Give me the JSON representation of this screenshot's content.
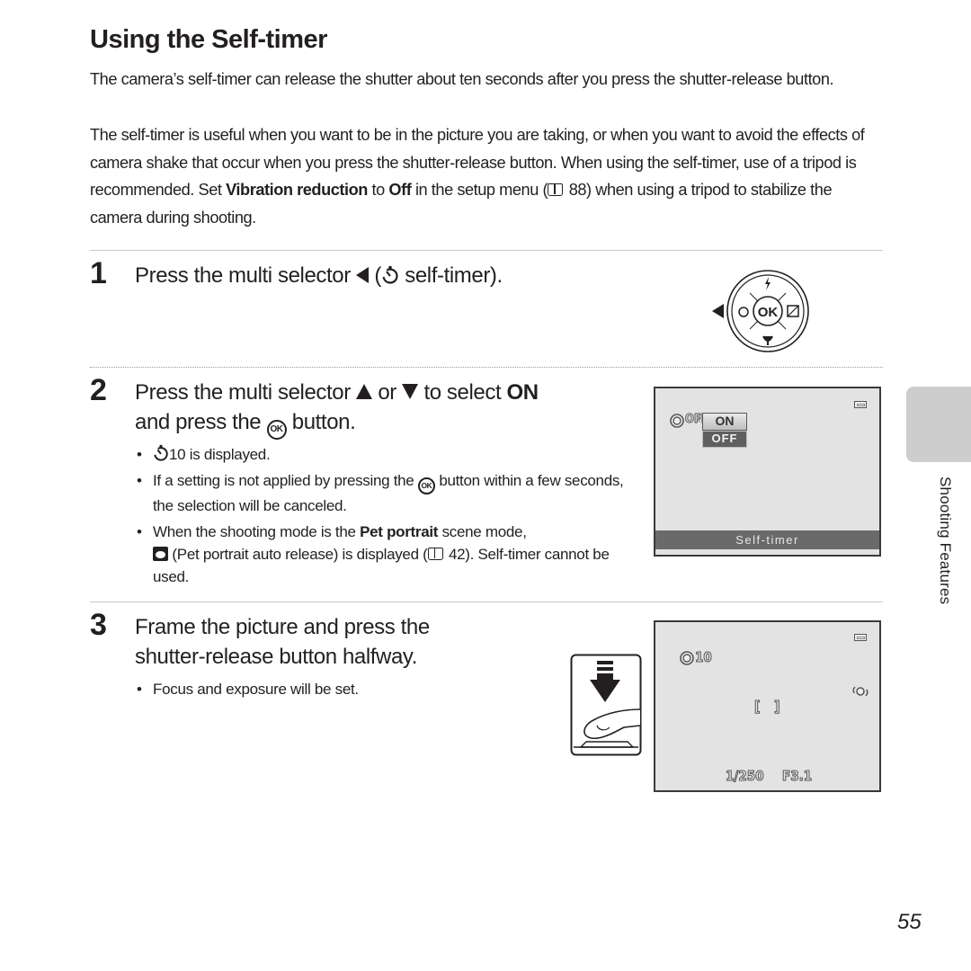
{
  "page": {
    "title": "Using the Self-timer",
    "intro_p1": "The camera’s self-timer can release the shutter about ten seconds after you press the shutter-release button.",
    "intro_p2_a": "The self-timer is useful when you want to be in the picture you are taking, or when you want to avoid the effects of camera shake that occur when you press the shutter-release button. When using the self-timer, use of a tripod is recommended. Set ",
    "intro_p2_bold1": "Vibration reduction",
    "intro_p2_b": " to ",
    "intro_p2_bold2": "Off",
    "intro_p2_c": " in the setup menu (",
    "intro_p2_ref": "88",
    "intro_p2_d": ") when using a tripod to stabilize the camera during shooting.",
    "page_number": "55",
    "side_tab_label": "Shooting Features"
  },
  "steps": [
    {
      "number": "1",
      "head_a": "Press the multi selector ",
      "head_b": " (",
      "head_c": " self-timer).",
      "selector_icons": [
        "flash-icon",
        "self-timer-icon",
        "ok-button",
        "exposure-comp-icon",
        "macro-icon"
      ],
      "ok_label": "OK"
    },
    {
      "number": "2",
      "head_a": "Press the multi selector ",
      "head_b": " or ",
      "head_c": " to select ",
      "head_bold": "ON",
      "head_d": "and press the ",
      "head_e": " button.",
      "ok_label": "OK",
      "bullets": [
        {
          "text": "10 is displayed."
        },
        {
          "text_a": "If a setting is not applied by pressing the ",
          "text_b": " button within a few seconds, the selection will be canceled."
        },
        {
          "text_a": "When the shooting mode is the ",
          "bold": "Pet portrait",
          "text_b": " scene mode, ",
          "text_c": " (Pet portrait auto release) is displayed (",
          "ref": "42",
          "text_d": "). Self-timer cannot be used."
        }
      ],
      "screen": {
        "indicator": "OFF",
        "options": [
          "ON",
          "OFF"
        ],
        "selected": "ON",
        "caption": "Self-timer"
      }
    },
    {
      "number": "3",
      "head_a": "Frame the picture and press the",
      "head_b": "shutter-release button halfway.",
      "bullets": [
        {
          "text": "Focus and exposure will be set."
        }
      ],
      "screen": {
        "timer_value": "10",
        "shutter_speed": "1/250",
        "aperture": "F3.1"
      }
    }
  ]
}
